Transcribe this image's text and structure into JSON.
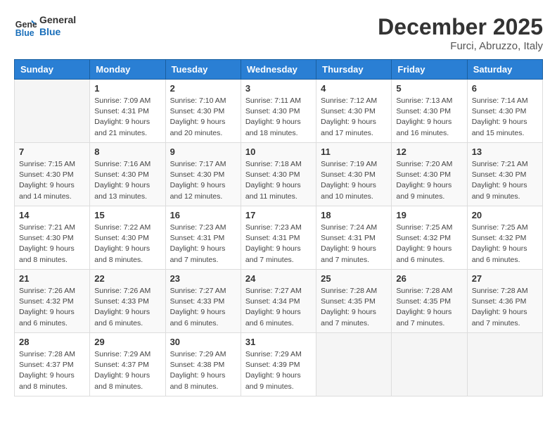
{
  "logo": {
    "line1": "General",
    "line2": "Blue"
  },
  "title": "December 2025",
  "location": "Furci, Abruzzo, Italy",
  "weekdays": [
    "Sunday",
    "Monday",
    "Tuesday",
    "Wednesday",
    "Thursday",
    "Friday",
    "Saturday"
  ],
  "weeks": [
    [
      {
        "day": "",
        "sunrise": "",
        "sunset": "",
        "daylight": ""
      },
      {
        "day": "1",
        "sunrise": "Sunrise: 7:09 AM",
        "sunset": "Sunset: 4:31 PM",
        "daylight": "Daylight: 9 hours and 21 minutes."
      },
      {
        "day": "2",
        "sunrise": "Sunrise: 7:10 AM",
        "sunset": "Sunset: 4:30 PM",
        "daylight": "Daylight: 9 hours and 20 minutes."
      },
      {
        "day": "3",
        "sunrise": "Sunrise: 7:11 AM",
        "sunset": "Sunset: 4:30 PM",
        "daylight": "Daylight: 9 hours and 18 minutes."
      },
      {
        "day": "4",
        "sunrise": "Sunrise: 7:12 AM",
        "sunset": "Sunset: 4:30 PM",
        "daylight": "Daylight: 9 hours and 17 minutes."
      },
      {
        "day": "5",
        "sunrise": "Sunrise: 7:13 AM",
        "sunset": "Sunset: 4:30 PM",
        "daylight": "Daylight: 9 hours and 16 minutes."
      },
      {
        "day": "6",
        "sunrise": "Sunrise: 7:14 AM",
        "sunset": "Sunset: 4:30 PM",
        "daylight": "Daylight: 9 hours and 15 minutes."
      }
    ],
    [
      {
        "day": "7",
        "sunrise": "Sunrise: 7:15 AM",
        "sunset": "Sunset: 4:30 PM",
        "daylight": "Daylight: 9 hours and 14 minutes."
      },
      {
        "day": "8",
        "sunrise": "Sunrise: 7:16 AM",
        "sunset": "Sunset: 4:30 PM",
        "daylight": "Daylight: 9 hours and 13 minutes."
      },
      {
        "day": "9",
        "sunrise": "Sunrise: 7:17 AM",
        "sunset": "Sunset: 4:30 PM",
        "daylight": "Daylight: 9 hours and 12 minutes."
      },
      {
        "day": "10",
        "sunrise": "Sunrise: 7:18 AM",
        "sunset": "Sunset: 4:30 PM",
        "daylight": "Daylight: 9 hours and 11 minutes."
      },
      {
        "day": "11",
        "sunrise": "Sunrise: 7:19 AM",
        "sunset": "Sunset: 4:30 PM",
        "daylight": "Daylight: 9 hours and 10 minutes."
      },
      {
        "day": "12",
        "sunrise": "Sunrise: 7:20 AM",
        "sunset": "Sunset: 4:30 PM",
        "daylight": "Daylight: 9 hours and 9 minutes."
      },
      {
        "day": "13",
        "sunrise": "Sunrise: 7:21 AM",
        "sunset": "Sunset: 4:30 PM",
        "daylight": "Daylight: 9 hours and 9 minutes."
      }
    ],
    [
      {
        "day": "14",
        "sunrise": "Sunrise: 7:21 AM",
        "sunset": "Sunset: 4:30 PM",
        "daylight": "Daylight: 9 hours and 8 minutes."
      },
      {
        "day": "15",
        "sunrise": "Sunrise: 7:22 AM",
        "sunset": "Sunset: 4:30 PM",
        "daylight": "Daylight: 9 hours and 8 minutes."
      },
      {
        "day": "16",
        "sunrise": "Sunrise: 7:23 AM",
        "sunset": "Sunset: 4:31 PM",
        "daylight": "Daylight: 9 hours and 7 minutes."
      },
      {
        "day": "17",
        "sunrise": "Sunrise: 7:23 AM",
        "sunset": "Sunset: 4:31 PM",
        "daylight": "Daylight: 9 hours and 7 minutes."
      },
      {
        "day": "18",
        "sunrise": "Sunrise: 7:24 AM",
        "sunset": "Sunset: 4:31 PM",
        "daylight": "Daylight: 9 hours and 7 minutes."
      },
      {
        "day": "19",
        "sunrise": "Sunrise: 7:25 AM",
        "sunset": "Sunset: 4:32 PM",
        "daylight": "Daylight: 9 hours and 6 minutes."
      },
      {
        "day": "20",
        "sunrise": "Sunrise: 7:25 AM",
        "sunset": "Sunset: 4:32 PM",
        "daylight": "Daylight: 9 hours and 6 minutes."
      }
    ],
    [
      {
        "day": "21",
        "sunrise": "Sunrise: 7:26 AM",
        "sunset": "Sunset: 4:32 PM",
        "daylight": "Daylight: 9 hours and 6 minutes."
      },
      {
        "day": "22",
        "sunrise": "Sunrise: 7:26 AM",
        "sunset": "Sunset: 4:33 PM",
        "daylight": "Daylight: 9 hours and 6 minutes."
      },
      {
        "day": "23",
        "sunrise": "Sunrise: 7:27 AM",
        "sunset": "Sunset: 4:33 PM",
        "daylight": "Daylight: 9 hours and 6 minutes."
      },
      {
        "day": "24",
        "sunrise": "Sunrise: 7:27 AM",
        "sunset": "Sunset: 4:34 PM",
        "daylight": "Daylight: 9 hours and 6 minutes."
      },
      {
        "day": "25",
        "sunrise": "Sunrise: 7:28 AM",
        "sunset": "Sunset: 4:35 PM",
        "daylight": "Daylight: 9 hours and 7 minutes."
      },
      {
        "day": "26",
        "sunrise": "Sunrise: 7:28 AM",
        "sunset": "Sunset: 4:35 PM",
        "daylight": "Daylight: 9 hours and 7 minutes."
      },
      {
        "day": "27",
        "sunrise": "Sunrise: 7:28 AM",
        "sunset": "Sunset: 4:36 PM",
        "daylight": "Daylight: 9 hours and 7 minutes."
      }
    ],
    [
      {
        "day": "28",
        "sunrise": "Sunrise: 7:28 AM",
        "sunset": "Sunset: 4:37 PM",
        "daylight": "Daylight: 9 hours and 8 minutes."
      },
      {
        "day": "29",
        "sunrise": "Sunrise: 7:29 AM",
        "sunset": "Sunset: 4:37 PM",
        "daylight": "Daylight: 9 hours and 8 minutes."
      },
      {
        "day": "30",
        "sunrise": "Sunrise: 7:29 AM",
        "sunset": "Sunset: 4:38 PM",
        "daylight": "Daylight: 9 hours and 8 minutes."
      },
      {
        "day": "31",
        "sunrise": "Sunrise: 7:29 AM",
        "sunset": "Sunset: 4:39 PM",
        "daylight": "Daylight: 9 hours and 9 minutes."
      },
      {
        "day": "",
        "sunrise": "",
        "sunset": "",
        "daylight": ""
      },
      {
        "day": "",
        "sunrise": "",
        "sunset": "",
        "daylight": ""
      },
      {
        "day": "",
        "sunrise": "",
        "sunset": "",
        "daylight": ""
      }
    ]
  ]
}
